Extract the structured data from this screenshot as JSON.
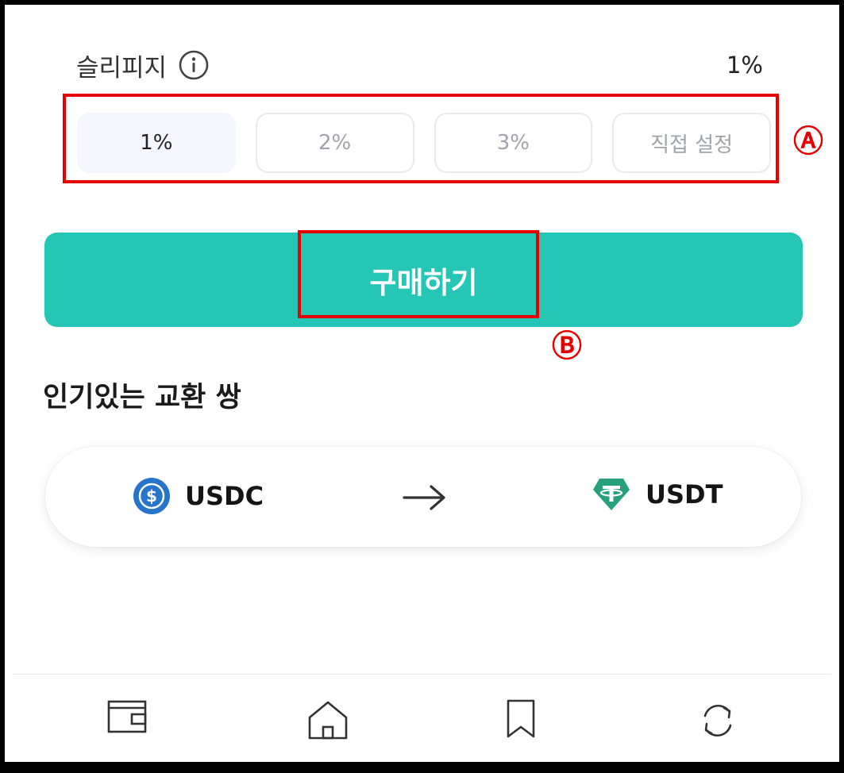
{
  "slippage": {
    "label": "슬리피지",
    "value": "1%",
    "options": [
      {
        "label": "1%",
        "selected": true
      },
      {
        "label": "2%",
        "selected": false
      },
      {
        "label": "3%",
        "selected": false
      },
      {
        "label": "직접 설정",
        "selected": false
      }
    ]
  },
  "annotations": {
    "a": "Ⓐ",
    "b": "Ⓑ"
  },
  "buy_button": {
    "label": "구매하기"
  },
  "popular_pairs": {
    "title": "인기있는 교환 쌍",
    "pair": {
      "from": "USDC",
      "to": "USDT"
    }
  },
  "nav": {
    "items": [
      "wallet-icon",
      "home-icon",
      "bookmark-icon",
      "swap-icon"
    ]
  },
  "colors": {
    "accent": "#25c6b5",
    "annotation": "#e60000",
    "usdc": "#2775ca",
    "usdt": "#26a17b"
  }
}
